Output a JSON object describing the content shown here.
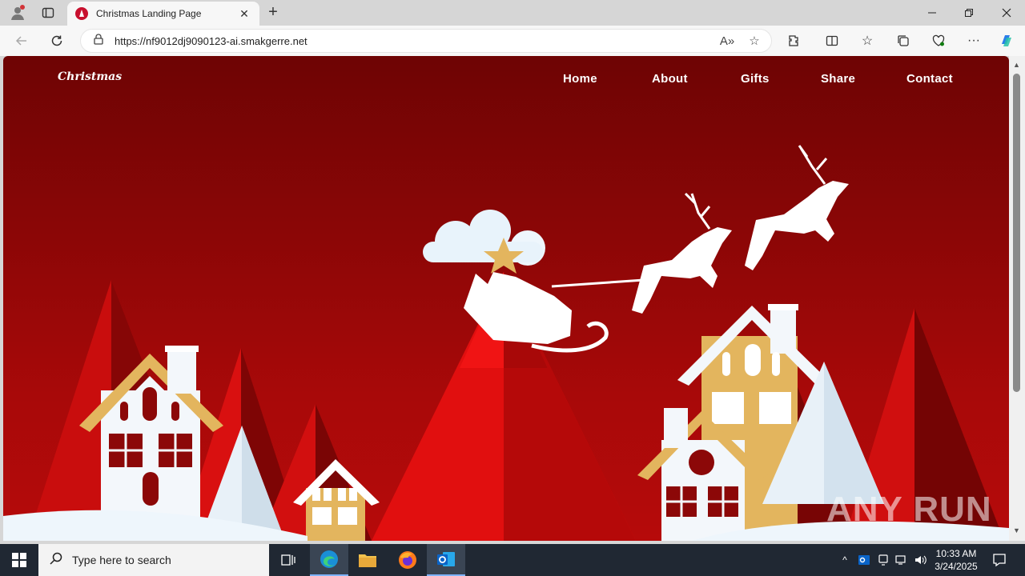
{
  "browser": {
    "tab_title": "Christmas Landing Page",
    "url": "https://nf9012dj9090123-ai.smakgerre.net",
    "new_tab_label": "+",
    "tab_close": "✕"
  },
  "site": {
    "logo": "Christmas",
    "nav": [
      "Home",
      "About",
      "Gifts",
      "Share",
      "Contact"
    ]
  },
  "watermark": "ANY RUN",
  "taskbar": {
    "search_placeholder": "Type here to search",
    "time": "10:33 AM",
    "date": "3/24/2025"
  },
  "colors": {
    "hero_red": "#a80909",
    "deep_red": "#6e0404",
    "gold": "#e3b55e",
    "snow": "#eef6fc"
  }
}
